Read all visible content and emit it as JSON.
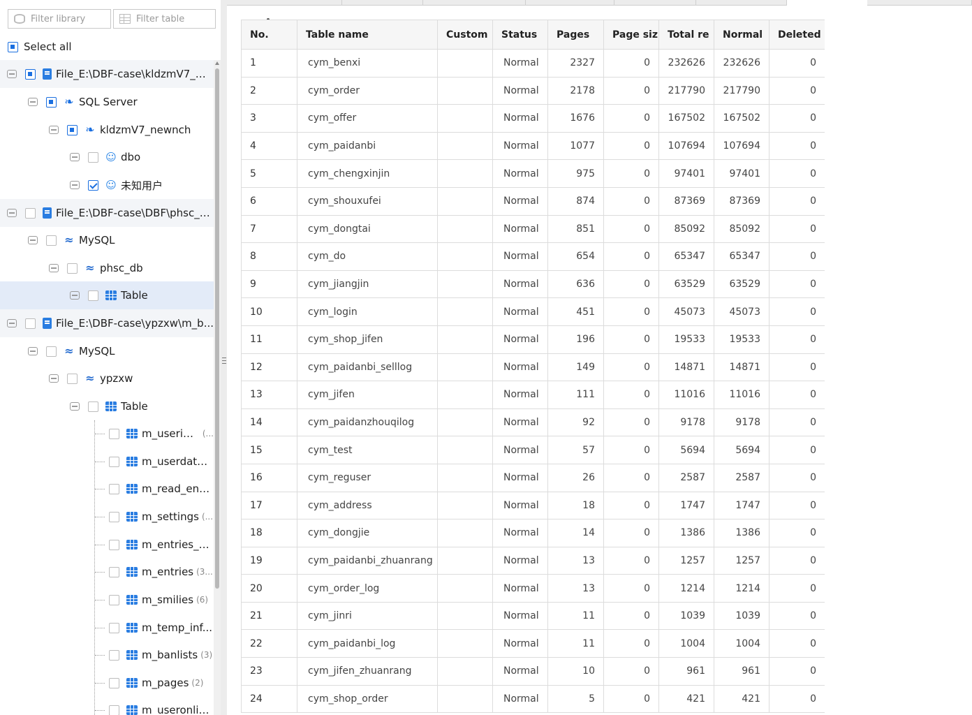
{
  "filters": {
    "library_placeholder": "Filter library",
    "table_placeholder": "Filter table"
  },
  "select_all_label": "Select all",
  "tree": [
    {
      "label": "File_E:\\DBF-case\\kldzmV7_Da...",
      "icon": "file-icon",
      "state": "partial"
    },
    {
      "label": "SQL Server",
      "icon": "sqlserver-icon",
      "state": "partial"
    },
    {
      "label": "kldzmV7_newnch",
      "icon": "sqlserver-icon",
      "state": "partial"
    },
    {
      "label": "dbo",
      "icon": "user-icon",
      "state": "unchecked"
    },
    {
      "label": "未知用户",
      "icon": "user-icon",
      "state": "checked"
    },
    {
      "label": "File_E:\\DBF-case\\DBF\\phsc_d...",
      "icon": "file-icon",
      "state": "unchecked"
    },
    {
      "label": "MySQL",
      "icon": "mysql-icon",
      "state": "unchecked"
    },
    {
      "label": "phsc_db",
      "icon": "mysql-icon",
      "state": "unchecked"
    },
    {
      "label": "Table",
      "icon": "table-icon",
      "state": "unchecked"
    },
    {
      "label": "File_E:\\DBF-case\\ypzxw\\m_b...",
      "icon": "file-icon",
      "state": "unchecked"
    },
    {
      "label": "MySQL",
      "icon": "mysql-icon",
      "state": "unchecked"
    },
    {
      "label": "ypzxw",
      "icon": "mysql-icon",
      "state": "unchecked"
    },
    {
      "label": "Table",
      "icon": "table-icon",
      "state": "unchecked"
    },
    {
      "label": "m_userinfo",
      "count": "(...",
      "icon": "table-icon",
      "state": "unchecked"
    },
    {
      "label": "m_userdata ...",
      "icon": "table-icon",
      "state": "unchecked"
    },
    {
      "label": "m_read_entr...",
      "icon": "table-icon",
      "state": "unchecked"
    },
    {
      "label": "m_settings",
      "count": "(...",
      "icon": "table-icon",
      "state": "unchecked"
    },
    {
      "label": "m_entries_c...",
      "icon": "table-icon",
      "state": "unchecked"
    },
    {
      "label": "m_entries",
      "count": "(3...",
      "icon": "table-icon",
      "state": "unchecked"
    },
    {
      "label": "m_smilies",
      "count": "(6)",
      "icon": "table-icon",
      "state": "unchecked"
    },
    {
      "label": "m_temp_inf...",
      "icon": "table-icon",
      "state": "unchecked"
    },
    {
      "label": "m_banlists",
      "count": "(3)",
      "icon": "table-icon",
      "state": "unchecked"
    },
    {
      "label": "m_pages",
      "count": "(2)",
      "icon": "table-icon",
      "state": "unchecked"
    },
    {
      "label": "m_useronlin...",
      "icon": "table-icon",
      "state": "unchecked"
    }
  ],
  "table": {
    "columns": [
      "No.",
      "Table name",
      "Custom",
      "Status",
      "Pages",
      "Page siz",
      "Total re",
      "Normal",
      "Deleted"
    ],
    "rows": [
      [
        "1",
        "cym_benxi",
        "",
        "Normal",
        "2327",
        "0",
        "232626",
        "232626",
        "0"
      ],
      [
        "2",
        "cym_order",
        "",
        "Normal",
        "2178",
        "0",
        "217790",
        "217790",
        "0"
      ],
      [
        "3",
        "cym_offer",
        "",
        "Normal",
        "1676",
        "0",
        "167502",
        "167502",
        "0"
      ],
      [
        "4",
        "cym_paidanbi",
        "",
        "Normal",
        "1077",
        "0",
        "107694",
        "107694",
        "0"
      ],
      [
        "5",
        "cym_chengxinjin",
        "",
        "Normal",
        "975",
        "0",
        "97401",
        "97401",
        "0"
      ],
      [
        "6",
        "cym_shouxufei",
        "",
        "Normal",
        "874",
        "0",
        "87369",
        "87369",
        "0"
      ],
      [
        "7",
        "cym_dongtai",
        "",
        "Normal",
        "851",
        "0",
        "85092",
        "85092",
        "0"
      ],
      [
        "8",
        "cym_do",
        "",
        "Normal",
        "654",
        "0",
        "65347",
        "65347",
        "0"
      ],
      [
        "9",
        "cym_jiangjin",
        "",
        "Normal",
        "636",
        "0",
        "63529",
        "63529",
        "0"
      ],
      [
        "10",
        "cym_login",
        "",
        "Normal",
        "451",
        "0",
        "45073",
        "45073",
        "0"
      ],
      [
        "11",
        "cym_shop_jifen",
        "",
        "Normal",
        "196",
        "0",
        "19533",
        "19533",
        "0"
      ],
      [
        "12",
        "cym_paidanbi_selllog",
        "",
        "Normal",
        "149",
        "0",
        "14871",
        "14871",
        "0"
      ],
      [
        "13",
        "cym_jifen",
        "",
        "Normal",
        "111",
        "0",
        "11016",
        "11016",
        "0"
      ],
      [
        "14",
        "cym_paidanzhouqilog",
        "",
        "Normal",
        "92",
        "0",
        "9178",
        "9178",
        "0"
      ],
      [
        "15",
        "cym_test",
        "",
        "Normal",
        "57",
        "0",
        "5694",
        "5694",
        "0"
      ],
      [
        "16",
        "cym_reguser",
        "",
        "Normal",
        "26",
        "0",
        "2587",
        "2587",
        "0"
      ],
      [
        "17",
        "cym_address",
        "",
        "Normal",
        "18",
        "0",
        "1747",
        "1747",
        "0"
      ],
      [
        "18",
        "cym_dongjie",
        "",
        "Normal",
        "14",
        "0",
        "1386",
        "1386",
        "0"
      ],
      [
        "19",
        "cym_paidanbi_zhuanrang",
        "",
        "Normal",
        "13",
        "0",
        "1257",
        "1257",
        "0"
      ],
      [
        "20",
        "cym_order_log",
        "",
        "Normal",
        "13",
        "0",
        "1214",
        "1214",
        "0"
      ],
      [
        "21",
        "cym_jinri",
        "",
        "Normal",
        "11",
        "0",
        "1039",
        "1039",
        "0"
      ],
      [
        "22",
        "cym_paidanbi_log",
        "",
        "Normal",
        "11",
        "0",
        "1004",
        "1004",
        "0"
      ],
      [
        "23",
        "cym_jifen_zhuanrang",
        "",
        "Normal",
        "10",
        "0",
        "961",
        "961",
        "0"
      ],
      [
        "24",
        "cym_shop_order",
        "",
        "Normal",
        "5",
        "0",
        "421",
        "421",
        "0"
      ]
    ]
  }
}
